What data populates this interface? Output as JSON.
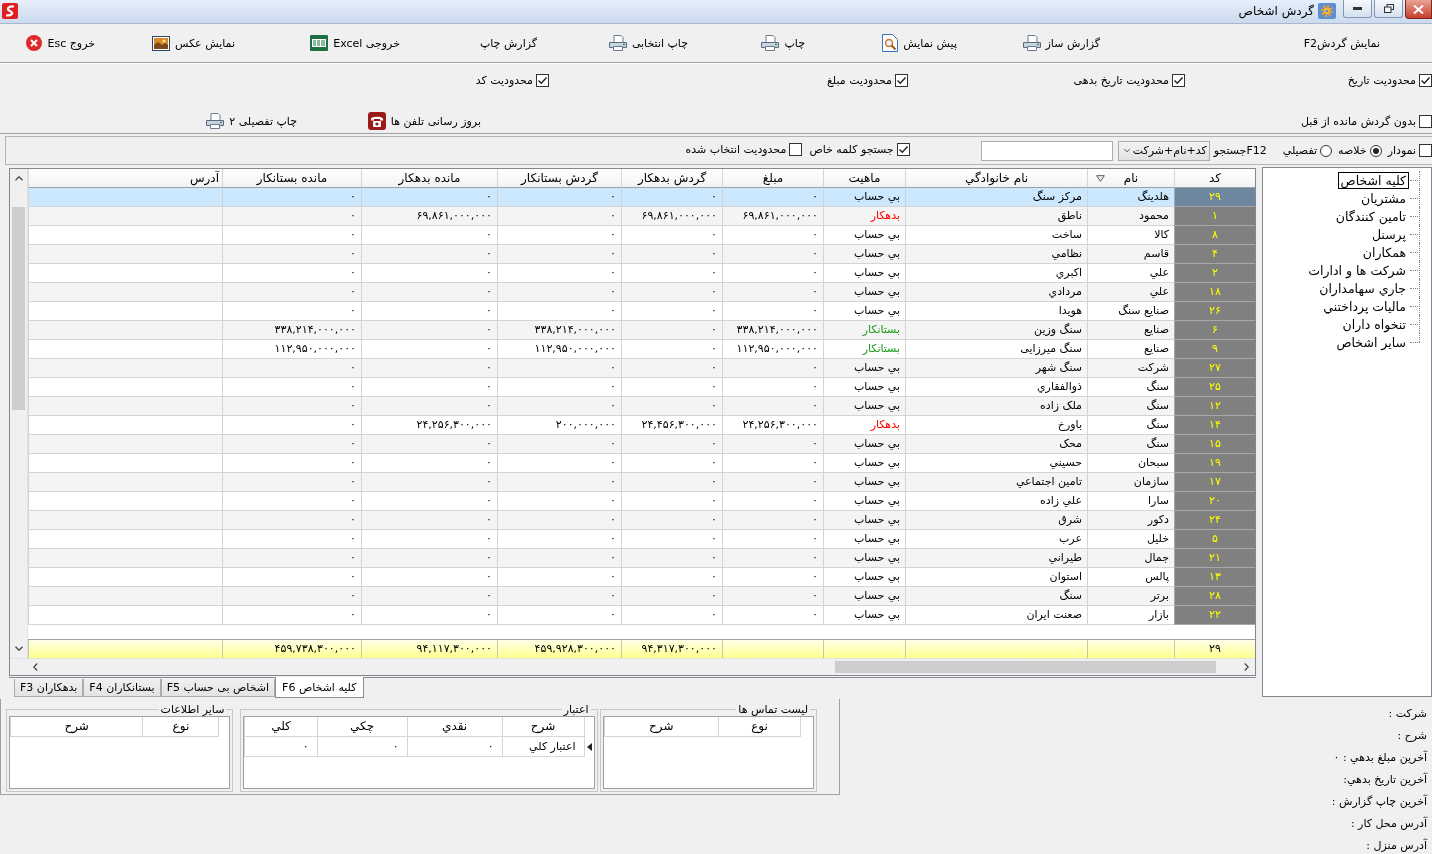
{
  "window": {
    "title": "گردش اشخاص"
  },
  "toolbar": [
    {
      "label": "نمایش گردشF2",
      "kind": "text"
    },
    {
      "label": "گزارش ساز",
      "kind": "printer"
    },
    {
      "label": "پیش نمایش",
      "kind": "preview"
    },
    {
      "label": "چاپ",
      "kind": "printer"
    },
    {
      "label": "چاپ انتخابی",
      "kind": "printer"
    },
    {
      "label": "گزارش چاپ",
      "kind": "text"
    },
    {
      "label": "خروجی Excel",
      "kind": "excel"
    },
    {
      "label": "نمایش عکس",
      "kind": "picture"
    },
    {
      "label": "خروج Esc",
      "kind": "exit"
    }
  ],
  "filters": [
    {
      "label": "محدودیت تاریخ",
      "checked": true
    },
    {
      "label": "محدودیت تاریخ بدهی",
      "checked": true
    },
    {
      "label": "محدودیت مبلغ",
      "checked": true
    },
    {
      "label": "محدودیت کد",
      "checked": true
    }
  ],
  "options": {
    "no_prior_balance": {
      "label": "بدون گردش مانده از قبل",
      "checked": false
    },
    "actions": [
      {
        "label": "بروز رسانی تلفن ها",
        "kind": "phone"
      },
      {
        "label": "چاپ تفصیلی ۲",
        "kind": "printer"
      }
    ]
  },
  "search_bar": {
    "chart": {
      "label": "نمودار",
      "checked": false
    },
    "view_modes": [
      {
        "label": "خلاصه",
        "selected": true
      },
      {
        "label": "تفصیلي",
        "selected": false
      }
    ],
    "search_label": "F12جستجو",
    "search_by": "کد+نام+شرکت",
    "keyword_search": {
      "label": "جستجو کلمه خاص",
      "checked": true
    },
    "selection_limit": {
      "label": "محدودیت انتخاب شده",
      "checked": false
    }
  },
  "table": {
    "columns": [
      {
        "label": "کد",
        "sorted": false
      },
      {
        "label": "نام",
        "sorted": true
      },
      {
        "label": "نام خانوادگي",
        "sorted": false
      },
      {
        "label": "ماهیت",
        "sorted": false
      },
      {
        "label": "مبلغ",
        "sorted": false
      },
      {
        "label": "گردش بدهکار",
        "sorted": false
      },
      {
        "label": "گردش بستانکار",
        "sorted": false
      },
      {
        "label": "مانده بدهکار",
        "sorted": false
      },
      {
        "label": "مانده بستانکار",
        "sorted": false
      },
      {
        "label": "آدرس",
        "sorted": false
      }
    ],
    "rows": [
      {
        "code": "۲۹",
        "name": "هلدینگ",
        "family": "مرکز سنگ",
        "nature": "بي حساب",
        "color": "#000000",
        "amount": "۰",
        "debit_turnover": "۰",
        "credit_turnover": "۰",
        "debit_balance": "۰",
        "credit_balance": "۰",
        "selected": true
      },
      {
        "code": "۱",
        "name": "محمود",
        "family": "ناطق",
        "nature": "بدهکار",
        "color": "#ff0000",
        "amount": "۶۹,۸۶۱,۰۰۰,۰۰۰",
        "debit_turnover": "۶۹,۸۶۱,۰۰۰,۰۰۰",
        "credit_turnover": "۰",
        "debit_balance": "۶۹,۸۶۱,۰۰۰,۰۰۰",
        "credit_balance": "۰",
        "selected": false
      },
      {
        "code": "۸",
        "name": "کالا",
        "family": "ساخت",
        "nature": "بي حساب",
        "color": "#000000",
        "amount": "۰",
        "debit_turnover": "۰",
        "credit_turnover": "۰",
        "debit_balance": "۰",
        "credit_balance": "۰",
        "selected": false
      },
      {
        "code": "۴",
        "name": "قاسم",
        "family": "نظامي",
        "nature": "بي حساب",
        "color": "#000000",
        "amount": "۰",
        "debit_turnover": "۰",
        "credit_turnover": "۰",
        "debit_balance": "۰",
        "credit_balance": "۰",
        "selected": false
      },
      {
        "code": "۲",
        "name": "علي",
        "family": "اکبري",
        "nature": "بي حساب",
        "color": "#000000",
        "amount": "۰",
        "debit_turnover": "۰",
        "credit_turnover": "۰",
        "debit_balance": "۰",
        "credit_balance": "۰",
        "selected": false
      },
      {
        "code": "۱۸",
        "name": "علي",
        "family": "مردادي",
        "nature": "بي حساب",
        "color": "#000000",
        "amount": "۰",
        "debit_turnover": "۰",
        "credit_turnover": "۰",
        "debit_balance": "۰",
        "credit_balance": "۰",
        "selected": false
      },
      {
        "code": "۲۶",
        "name": "صنایع سنگ",
        "family": "هویدا",
        "nature": "بي حساب",
        "color": "#000000",
        "amount": "۰",
        "debit_turnover": "۰",
        "credit_turnover": "۰",
        "debit_balance": "۰",
        "credit_balance": "۰",
        "selected": false
      },
      {
        "code": "۶",
        "name": "صنایع",
        "family": "سنگ وزین",
        "nature": "بستانکار",
        "color": "#1a9a1a",
        "amount": "۳۳۸,۲۱۴,۰۰۰,۰۰۰",
        "debit_turnover": "۰",
        "credit_turnover": "۳۳۸,۲۱۴,۰۰۰,۰۰۰",
        "debit_balance": "۰",
        "credit_balance": "۳۳۸,۲۱۴,۰۰۰,۰۰۰",
        "selected": false
      },
      {
        "code": "۹",
        "name": "صنایع",
        "family": "سنگ میرزایی",
        "nature": "بستانکار",
        "color": "#1a9a1a",
        "amount": "۱۱۲,۹۵۰,۰۰۰,۰۰۰",
        "debit_turnover": "۰",
        "credit_turnover": "۱۱۲,۹۵۰,۰۰۰,۰۰۰",
        "debit_balance": "۰",
        "credit_balance": "۱۱۲,۹۵۰,۰۰۰,۰۰۰",
        "selected": false
      },
      {
        "code": "۲۷",
        "name": "شرکت",
        "family": "سنگ شهر",
        "nature": "بي حساب",
        "color": "#000000",
        "amount": "۰",
        "debit_turnover": "۰",
        "credit_turnover": "۰",
        "debit_balance": "۰",
        "credit_balance": "۰",
        "selected": false
      },
      {
        "code": "۲۵",
        "name": "سنگ",
        "family": "ذوالفقاري",
        "nature": "بي حساب",
        "color": "#000000",
        "amount": "۰",
        "debit_turnover": "۰",
        "credit_turnover": "۰",
        "debit_balance": "۰",
        "credit_balance": "۰",
        "selected": false
      },
      {
        "code": "۱۲",
        "name": "سنگ",
        "family": "ملک زاده",
        "nature": "بي حساب",
        "color": "#000000",
        "amount": "۰",
        "debit_turnover": "۰",
        "credit_turnover": "۰",
        "debit_balance": "۰",
        "credit_balance": "۰",
        "selected": false
      },
      {
        "code": "۱۴",
        "name": "سنگ",
        "family": "باورخ",
        "nature": "بدهکار",
        "color": "#ff0000",
        "amount": "۲۴,۲۵۶,۳۰۰,۰۰۰",
        "debit_turnover": "۲۴,۴۵۶,۳۰۰,۰۰۰",
        "credit_turnover": "۲۰۰,۰۰۰,۰۰۰",
        "debit_balance": "۲۴,۲۵۶,۳۰۰,۰۰۰",
        "credit_balance": "۰",
        "selected": false
      },
      {
        "code": "۱۵",
        "name": "سنگ",
        "family": "محک",
        "nature": "بي حساب",
        "color": "#000000",
        "amount": "۰",
        "debit_turnover": "۰",
        "credit_turnover": "۰",
        "debit_balance": "۰",
        "credit_balance": "۰",
        "selected": false
      },
      {
        "code": "۱۹",
        "name": "سبحان",
        "family": "حسیني",
        "nature": "بي حساب",
        "color": "#000000",
        "amount": "۰",
        "debit_turnover": "۰",
        "credit_turnover": "۰",
        "debit_balance": "۰",
        "credit_balance": "۰",
        "selected": false
      },
      {
        "code": "۱۷",
        "name": "سازمان",
        "family": "تامین اجتماعي",
        "nature": "بي حساب",
        "color": "#000000",
        "amount": "۰",
        "debit_turnover": "۰",
        "credit_turnover": "۰",
        "debit_balance": "۰",
        "credit_balance": "۰",
        "selected": false
      },
      {
        "code": "۲۰",
        "name": "سارا",
        "family": "علي زاده",
        "nature": "بي حساب",
        "color": "#000000",
        "amount": "۰",
        "debit_turnover": "۰",
        "credit_turnover": "۰",
        "debit_balance": "۰",
        "credit_balance": "۰",
        "selected": false
      },
      {
        "code": "۲۴",
        "name": "دکور",
        "family": "شرق",
        "nature": "بي حساب",
        "color": "#000000",
        "amount": "۰",
        "debit_turnover": "۰",
        "credit_turnover": "۰",
        "debit_balance": "۰",
        "credit_balance": "۰",
        "selected": false
      },
      {
        "code": "۵",
        "name": "خلیل",
        "family": "عرب",
        "nature": "بي حساب",
        "color": "#000000",
        "amount": "۰",
        "debit_turnover": "۰",
        "credit_turnover": "۰",
        "debit_balance": "۰",
        "credit_balance": "۰",
        "selected": false
      },
      {
        "code": "۲۱",
        "name": "جمال",
        "family": "طیراني",
        "nature": "بي حساب",
        "color": "#000000",
        "amount": "۰",
        "debit_turnover": "۰",
        "credit_turnover": "۰",
        "debit_balance": "۰",
        "credit_balance": "۰",
        "selected": false
      },
      {
        "code": "۱۳",
        "name": "پالس",
        "family": "استوان",
        "nature": "بي حساب",
        "color": "#000000",
        "amount": "۰",
        "debit_turnover": "۰",
        "credit_turnover": "۰",
        "debit_balance": "۰",
        "credit_balance": "۰",
        "selected": false
      },
      {
        "code": "۲۸",
        "name": "برتر",
        "family": "سنگ",
        "nature": "بي حساب",
        "color": "#000000",
        "amount": "۰",
        "debit_turnover": "۰",
        "credit_turnover": "۰",
        "debit_balance": "۰",
        "credit_balance": "۰",
        "selected": false
      },
      {
        "code": "۲۲",
        "name": "بازار",
        "family": "صعنت ایران",
        "nature": "بي حساب",
        "color": "#000000",
        "amount": "۰",
        "debit_turnover": "۰",
        "credit_turnover": "۰",
        "debit_balance": "۰",
        "credit_balance": "۰",
        "selected": false
      }
    ],
    "footer": {
      "code": "۲۹",
      "debit_turnover": "۹۴,۳۱۷,۳۰۰,۰۰۰",
      "credit_turnover": "۴۵۹,۹۲۸,۳۰۰,۰۰۰",
      "debit_balance": "۹۴,۱۱۷,۳۰۰,۰۰۰",
      "credit_balance": "۴۵۹,۷۳۸,۳۰۰,۰۰۰"
    }
  },
  "tabs": [
    {
      "label": "کلیه اشخاص F6",
      "selected": true
    },
    {
      "label": "اشخاص بی حساب F5",
      "selected": false
    },
    {
      "label": "بستانکاران F4",
      "selected": false
    },
    {
      "label": "بدهکاران F3",
      "selected": false
    }
  ],
  "tree": {
    "items": [
      {
        "label": "کلیه اشخاص",
        "selected": true
      },
      {
        "label": "مشتریان",
        "selected": false
      },
      {
        "label": "تامین کنندگان",
        "selected": false
      },
      {
        "label": "پرسنل",
        "selected": false
      },
      {
        "label": "همکاران",
        "selected": false
      },
      {
        "label": "شرکت ها و ادارات",
        "selected": false
      },
      {
        "label": "جاري سهامداران",
        "selected": false
      },
      {
        "label": "مالیات پرداختني",
        "selected": false
      },
      {
        "label": "تنخواه داران",
        "selected": false
      },
      {
        "label": "سایر اشخاص",
        "selected": false
      }
    ]
  },
  "contacts": {
    "title": "لیست تماس ها",
    "columns": [
      "نوع",
      "شرح"
    ]
  },
  "credit": {
    "title": "اعتبار",
    "columns": [
      "شرح",
      "نقدي",
      "چکي",
      "کلي"
    ],
    "rows": [
      {
        "cells": [
          "اعتبار کلي",
          "۰",
          "۰",
          "۰"
        ],
        "current": true
      }
    ]
  },
  "other_info": {
    "title": "سایر اطلاعات",
    "columns": [
      "نوع",
      "شرح"
    ]
  },
  "details": [
    "شرکت :",
    "شرح :",
    "آخرین مبلغ بدهي : ۰",
    "آخرین تاریخ بدهي:",
    "آخرین چاپ گزارش :",
    "آدرس محل کار :",
    "آدرس منزل :"
  ]
}
